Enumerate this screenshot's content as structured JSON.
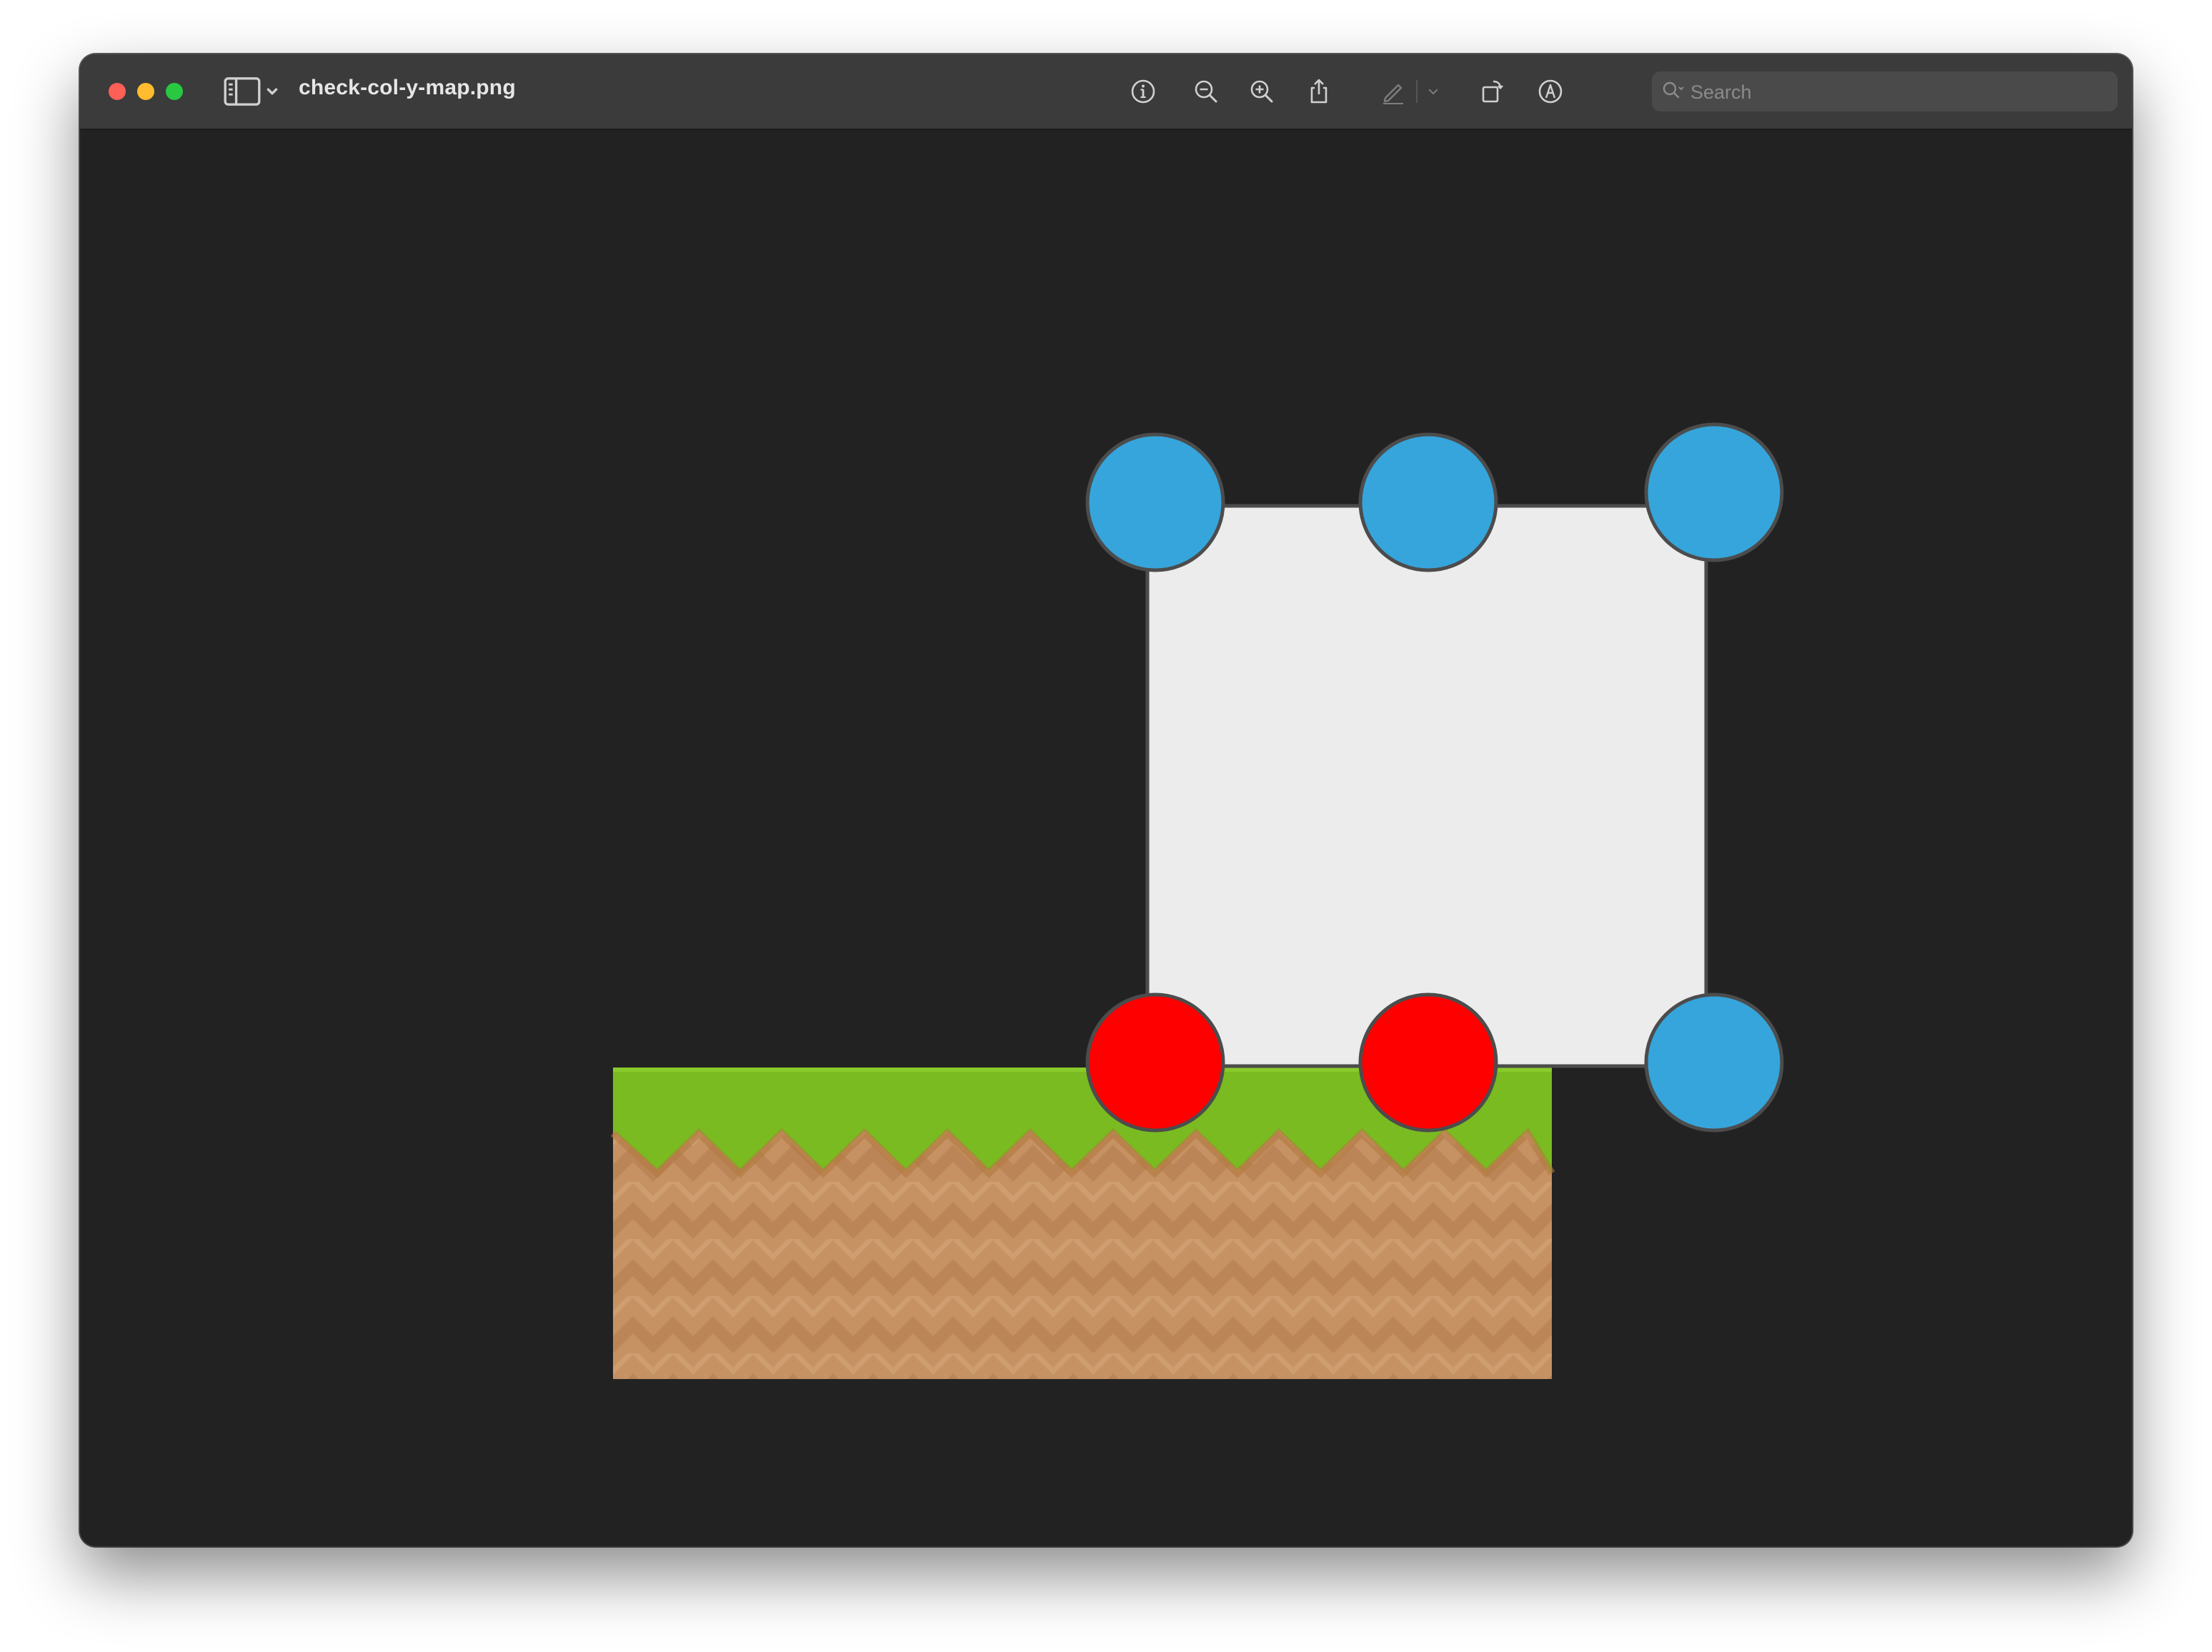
{
  "window": {
    "title": "check-col-y-map.png"
  },
  "toolbar": {
    "buttons": [
      {
        "name": "sidebar-toggle-button",
        "icon": "sidebar-icon"
      },
      {
        "name": "get-info-button",
        "icon": "info-icon"
      },
      {
        "name": "zoom-out-button",
        "icon": "zoom-out-icon"
      },
      {
        "name": "zoom-in-button",
        "icon": "zoom-in-icon"
      },
      {
        "name": "share-button",
        "icon": "share-icon"
      },
      {
        "name": "markup-pen-button",
        "icon": "pen-icon"
      },
      {
        "name": "rotate-button",
        "icon": "rotate-icon"
      },
      {
        "name": "markup-button",
        "icon": "markup-icon"
      },
      {
        "name": "sign-button",
        "icon": "signature-icon"
      }
    ],
    "search": {
      "placeholder": "Search"
    }
  },
  "colors": {
    "window_background": "#222222",
    "titlebar": "#3b3b3b",
    "box_fill": "#ececec",
    "outline": "#4c4c4c",
    "blue_point": "#35a5dc",
    "red_point": "#ff0000",
    "grass": "#79bb20",
    "dirt": "#c99565"
  },
  "scene": {
    "points": [
      {
        "name": "top-left-point",
        "state": "clear"
      },
      {
        "name": "top-center-point",
        "state": "clear"
      },
      {
        "name": "top-right-point",
        "state": "clear"
      },
      {
        "name": "bottom-left-point",
        "state": "colliding"
      },
      {
        "name": "bottom-center-point",
        "state": "colliding"
      },
      {
        "name": "bottom-right-point",
        "state": "clear"
      }
    ]
  }
}
